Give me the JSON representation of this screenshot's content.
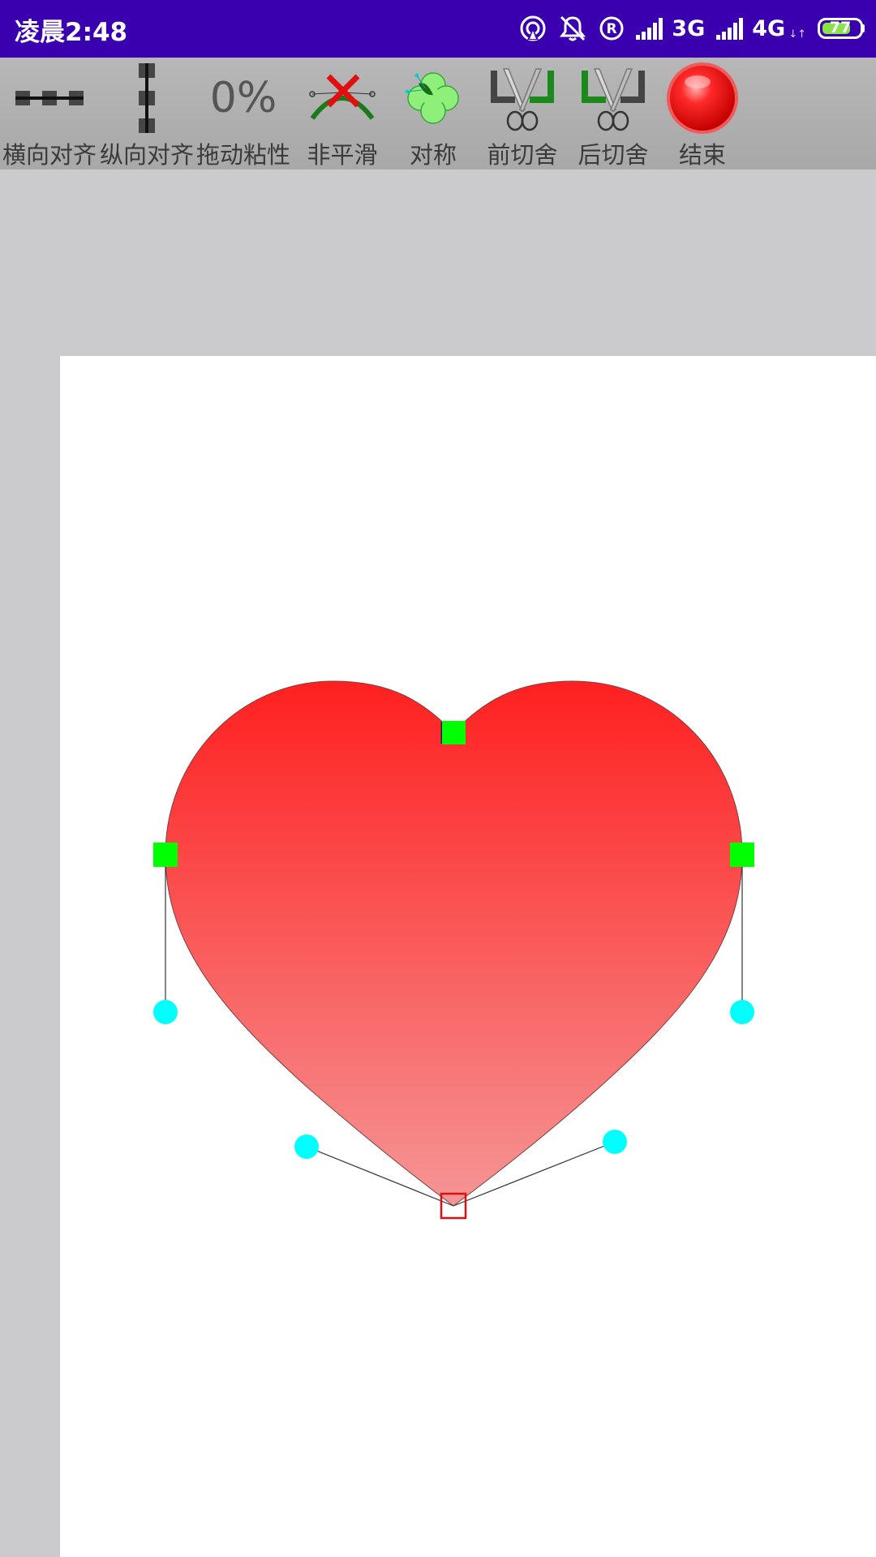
{
  "status_bar": {
    "time": "凌晨2:48",
    "network_1": "3G",
    "network_2": "4G",
    "network_2_suffix": "↓↑",
    "battery_level": "77",
    "battery_percent": 77,
    "icons": [
      "hotspot-icon",
      "mute-icon",
      "registered-icon",
      "signal-icon",
      "signal-icon",
      "battery-icon"
    ],
    "background_color": "#3a00b0"
  },
  "toolbar": {
    "items": [
      {
        "label": "横向对齐",
        "icon": "horizontal-align-icon"
      },
      {
        "label": "纵向对齐",
        "icon": "vertical-align-icon"
      },
      {
        "label": "拖动粘性",
        "icon_text": "0%"
      },
      {
        "label": "非平滑",
        "icon": "non-smooth-icon"
      },
      {
        "label": "对称",
        "icon": "symmetric-clover-icon"
      },
      {
        "label": "前切舍",
        "icon": "front-cut-scissors-icon"
      },
      {
        "label": "后切舍",
        "icon": "back-cut-scissors-icon"
      },
      {
        "label": "结束",
        "icon": "end-red-ball-icon"
      }
    ]
  },
  "drawing": {
    "shape": "heart",
    "fill_gradient": [
      "#ff2020",
      "#f59595"
    ],
    "anchor_color": "#00ff00",
    "handle_color": "#00ffff",
    "selected_anchor_color": "#e01010"
  }
}
